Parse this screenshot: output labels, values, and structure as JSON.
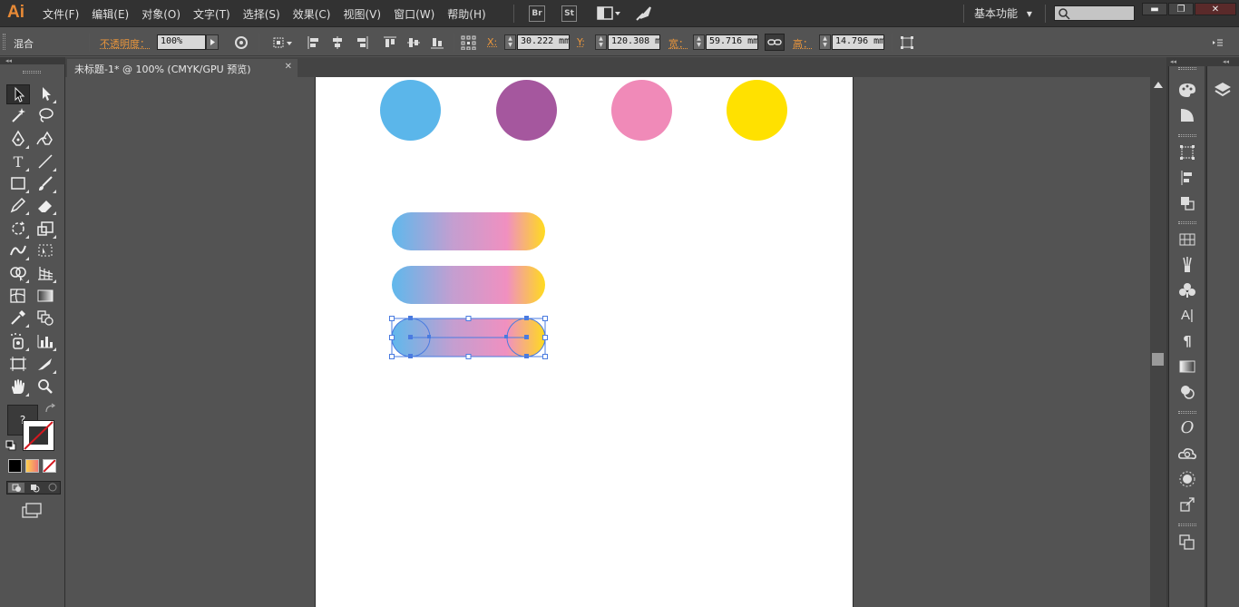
{
  "app": {
    "logo": "Ai"
  },
  "menu": [
    {
      "label": "文件(F)"
    },
    {
      "label": "编辑(E)"
    },
    {
      "label": "对象(O)"
    },
    {
      "label": "文字(T)"
    },
    {
      "label": "选择(S)"
    },
    {
      "label": "效果(C)"
    },
    {
      "label": "视图(V)"
    },
    {
      "label": "窗口(W)"
    },
    {
      "label": "帮助(H)"
    }
  ],
  "menubar_buttons": {
    "bridge": "Br",
    "stock": "St"
  },
  "workspace": {
    "label": "基本功能",
    "caret": "▾"
  },
  "window_controls": {
    "minimize": "▬",
    "restore": "❐",
    "close": "✕"
  },
  "control": {
    "selection_label": "混合",
    "opacity_label": "不透明度：",
    "opacity_value": "100%",
    "x_label": "X:",
    "x_value": "30.222 mm",
    "y_label": "Y:",
    "y_value": "120.308 m",
    "w_label": "宽：",
    "w_value": "59.716 mm",
    "h_label": "高：",
    "h_value": "14.796 mm"
  },
  "document": {
    "tab_label": "未标题-1* @ 100% (CMYK/GPU 预览)",
    "close": "✕"
  },
  "toolbox": {
    "fill_unknown": "?"
  },
  "colors": {
    "blue": "#5bb6ea",
    "purple": "#a5579e",
    "pink": "#f08ab8",
    "yellow": "#ffe100",
    "selection": "#4a7be0",
    "ai_orange": "#e88a36"
  },
  "icons": {
    "tools": [
      "selection-tool-icon",
      "direct-selection-tool-icon",
      "magic-wand-tool-icon",
      "lasso-tool-icon",
      "pen-tool-icon",
      "curvature-tool-icon",
      "type-tool-icon",
      "line-tool-icon",
      "rectangle-tool-icon",
      "paintbrush-tool-icon",
      "pencil-tool-icon",
      "eraser-tool-icon",
      "rotate-tool-icon",
      "scale-tool-icon",
      "warp-tool-icon",
      "free-transform-tool-icon",
      "shape-builder-tool-icon",
      "perspective-grid-tool-icon",
      "mesh-tool-icon",
      "gradient-tool-icon",
      "eyedropper-tool-icon",
      "blend-tool-icon",
      "symbol-sprayer-tool-icon",
      "column-graph-tool-icon",
      "artboard-tool-icon",
      "slice-tool-icon",
      "hand-tool-icon",
      "zoom-tool-icon"
    ],
    "panels": [
      "color-panel-icon",
      "color-guide-panel-icon",
      "transform-panel-icon",
      "align-panel-icon",
      "pathfinder-panel-icon",
      "swatches-panel-icon",
      "brushes-panel-icon",
      "symbols-panel-icon",
      "character-panel-icon",
      "paragraph-panel-icon",
      "gradient-panel-icon",
      "transparency-panel-icon",
      "opentype-panel-icon",
      "libraries-panel-icon",
      "appearance-panel-icon",
      "export-panel-icon",
      "artboards-panel-icon",
      "layers-panel-icon"
    ]
  }
}
